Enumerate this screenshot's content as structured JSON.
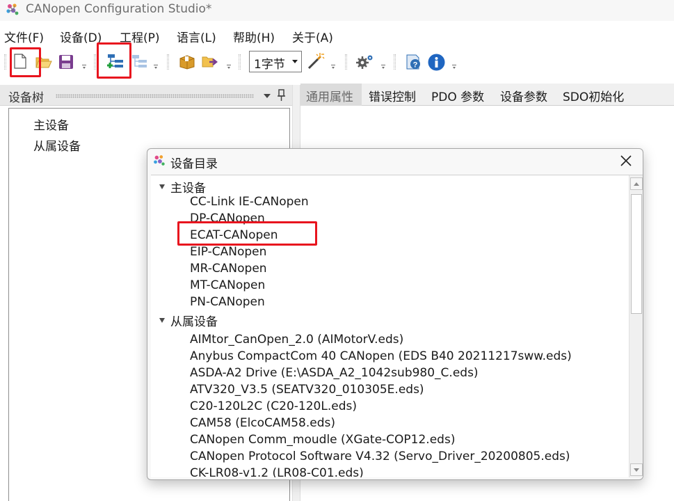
{
  "window": {
    "title": "CANopen Configuration Studio*"
  },
  "menu": [
    "文件(F)",
    "设备(D)",
    "工程(P)",
    "语言(L)",
    "帮助(H)",
    "关于(A)"
  ],
  "toolbar": {
    "byte_select": "1字节",
    "icons": [
      "new-file-icon",
      "open-folder-icon",
      "save-icon",
      "add-device-icon",
      "remove-device-icon",
      "package-icon",
      "export-icon",
      "byte-width-select",
      "magic-wand-icon",
      "settings-gear-icon",
      "help-icon",
      "info-icon"
    ],
    "highlighted": [
      "new-file-icon",
      "add-device-icon"
    ],
    "highlight_color": "#e8141e"
  },
  "left_pane": {
    "title": "设备树",
    "tree": [
      "主设备",
      "从属设备"
    ]
  },
  "tabs": [
    "通用属性",
    "错误控制",
    "PDO 参数",
    "设备参数",
    "SDO初始化"
  ],
  "dialog": {
    "title": "设备目录",
    "groups": [
      {
        "label": "主设备",
        "items": [
          "CC-Link IE-CANopen",
          "DP-CANopen",
          "ECAT-CANopen",
          "EIP-CANopen",
          "MR-CANopen",
          "MT-CANopen",
          "PN-CANopen"
        ]
      },
      {
        "label": "从属设备",
        "items": [
          "AIMtor_CanOpen_2.0 (AIMotorV.eds)",
          "Anybus CompactCom 40 CANopen (EDS B40 20211217sww.eds)",
          "ASDA-A2 Drive (E:\\ASDA_A2_1042sub980_C.eds)",
          "ATV320_V3.5 (SEATV320_010305E.eds)",
          "C20-120L2C (C20-120L.eds)",
          "CAM58 (ElcoCAM58.eds)",
          "CANopen Comm_moudle (XGate-COP12.eds)",
          "CANopen Protocol Software V4.32 (Servo_Driver_20200805.eds)",
          "CK-LR08-v1.2 (LR08-C01.eds)"
        ]
      }
    ],
    "highlighted_item": "ECAT-CANopen"
  }
}
